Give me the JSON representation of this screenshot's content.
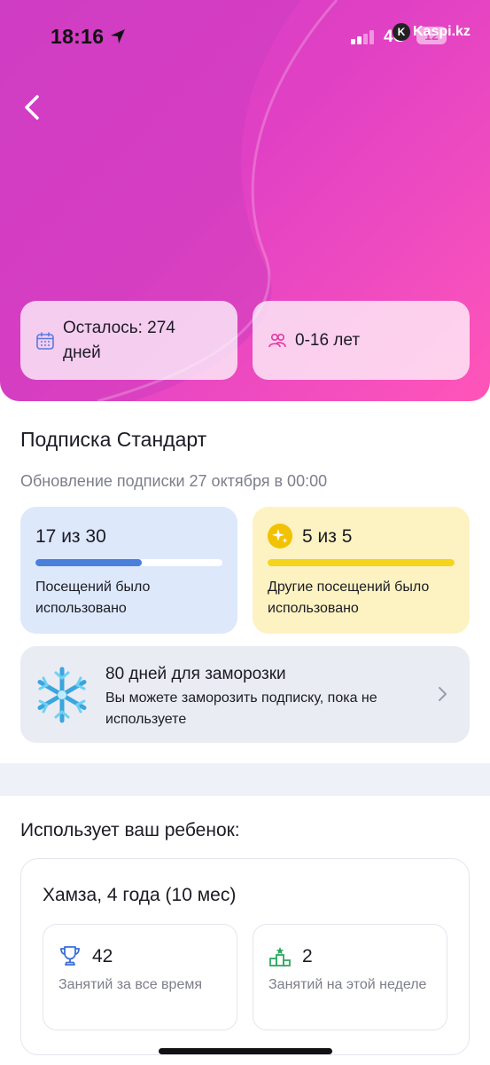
{
  "status_bar": {
    "time": "18:16",
    "network": "4G",
    "battery": "12",
    "watermark": "Kaspi.kz",
    "watermark_logo": "K"
  },
  "header": {
    "back_icon": "chevron-left-icon",
    "remaining": {
      "icon": "calendar-icon",
      "label": "Осталось: 274 дней"
    },
    "age": {
      "icon": "people-icon",
      "label": "0-16 лет"
    },
    "colors": {
      "gradient_start": "#d43ec8",
      "gradient_end": "#ff55b8"
    }
  },
  "subscription": {
    "title": "Подписка Стандарт",
    "renewal": "Обновление подписки 27 октября в 00:00",
    "visits": {
      "count_label": "17 из 30",
      "used": 17,
      "total": 30,
      "description": "Посещений было использовано",
      "color": "#4a7fdc"
    },
    "other_visits": {
      "icon": "sparkle-icon",
      "count_label": "5 из 5",
      "used": 5,
      "total": 5,
      "description": "Другие посещений было использовано",
      "color": "#f4d41c"
    },
    "freeze": {
      "icon": "snowflake-icon",
      "title": "80 дней для заморозки",
      "description": "Вы можете заморозить подписку, пока не используете"
    }
  },
  "child": {
    "heading": "Использует ваш ребенок:",
    "name": "Хамза, 4 года (10 мес)",
    "total": {
      "icon": "trophy-icon",
      "value": "42",
      "label": "Занятий за все время"
    },
    "week": {
      "icon": "podium-icon",
      "value": "2",
      "label": "Занятий на этой неделе"
    }
  }
}
